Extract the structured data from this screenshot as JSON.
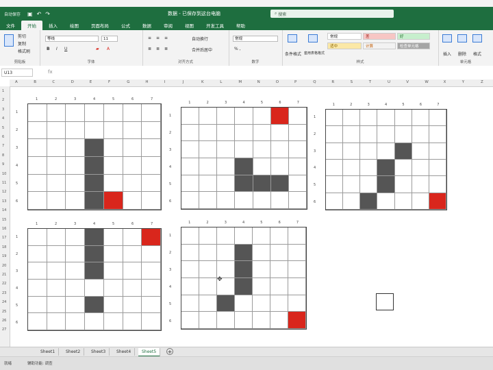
{
  "window": {
    "autosave_label": "自动保存",
    "title": "数据 - 已保存到这台电脑",
    "search_placeholder": "搜索"
  },
  "menu": [
    "文件",
    "开始",
    "插入",
    "绘图",
    "页面布局",
    "公式",
    "数据",
    "审阅",
    "视图",
    "开发工具",
    "帮助"
  ],
  "active_menu_index": 1,
  "ribbon": {
    "clipboard": {
      "label": "剪贴板",
      "cut": "剪切",
      "copy": "复制",
      "format_painter": "格式刷"
    },
    "font": {
      "label": "字体",
      "name": "等线",
      "size": "11"
    },
    "alignment": {
      "label": "对齐方式",
      "wrap": "自动换行",
      "merge": "合并后居中"
    },
    "number": {
      "label": "数字",
      "format": "常规"
    },
    "styles": {
      "label": "样式",
      "conditional": "条件格式",
      "table": "套用表格格式",
      "cells": [
        "常规",
        "差",
        "好",
        "适中",
        "计算",
        "检查单元格"
      ]
    },
    "cells": {
      "label": "单元格",
      "insert": "插入",
      "delete": "删除",
      "format": "格式"
    }
  },
  "formula": {
    "name_box": "U13",
    "fx": "fx"
  },
  "columns": [
    "A",
    "B",
    "C",
    "D",
    "E",
    "F",
    "G",
    "H",
    "I",
    "J",
    "K",
    "L",
    "M",
    "N",
    "O",
    "P",
    "Q",
    "R",
    "S",
    "T",
    "U",
    "V",
    "W",
    "X",
    "Y",
    "Z"
  ],
  "grids": [
    {
      "name": "grid-1",
      "col_labels": [
        "1",
        "2",
        "3",
        "4",
        "5",
        "6",
        "7"
      ],
      "row_labels": [
        "1",
        "2",
        "3",
        "4",
        "5",
        "6"
      ],
      "cells": [
        "wwwwwww",
        "wwwwwww",
        "wwwkwww",
        "wwwkwww",
        "wwwkwww",
        "wwwkrww"
      ]
    },
    {
      "name": "grid-2",
      "col_labels": [
        "1",
        "2",
        "3",
        "4",
        "5",
        "6",
        "7"
      ],
      "row_labels": [
        "1",
        "2",
        "3",
        "4",
        "5",
        "6"
      ],
      "cells": [
        "wwwwwrw",
        "wwwwwww",
        "wwwwwww",
        "wwwkwww",
        "wwwkkkw",
        "wwwwwww"
      ]
    },
    {
      "name": "grid-3",
      "col_labels": [
        "1",
        "2",
        "3",
        "4",
        "5",
        "6",
        "7"
      ],
      "row_labels": [
        "1",
        "2",
        "3",
        "4",
        "5",
        "6"
      ],
      "cells": [
        "wwwwwww",
        "wwwwwww",
        "wwwwkww",
        "wwwkwww",
        "wwwkwww",
        "wwkwwwr"
      ]
    },
    {
      "name": "grid-4",
      "col_labels": [
        "1",
        "2",
        "3",
        "4",
        "5",
        "6",
        "7"
      ],
      "row_labels": [
        "1",
        "2",
        "3",
        "4",
        "5",
        "6"
      ],
      "cells": [
        "wwwkwwr",
        "wwwkwww",
        "wwwkwww",
        "wwwwwww",
        "wwwkwww",
        "wwwwwww"
      ]
    },
    {
      "name": "grid-5",
      "col_labels": [
        "1",
        "2",
        "3",
        "4",
        "5",
        "6",
        "7"
      ],
      "row_labels": [
        "1",
        "2",
        "3",
        "4",
        "5",
        "6"
      ],
      "cells": [
        "wwwwwww",
        "wwwkwww",
        "wwwkwww",
        "wwwkwww",
        "wwkwwww",
        "wwwwwwr"
      ]
    }
  ],
  "sheet_tabs": [
    "Sheet1",
    "Sheet2",
    "Sheet3",
    "Sheet4",
    "Sheet5"
  ],
  "active_sheet": "Sheet5",
  "status": {
    "ready": "就绪",
    "accessibility": "辅助功能: 调查"
  },
  "colors": {
    "brand": "#1e6e3f",
    "filled": "#555555",
    "target": "#d9261c"
  }
}
